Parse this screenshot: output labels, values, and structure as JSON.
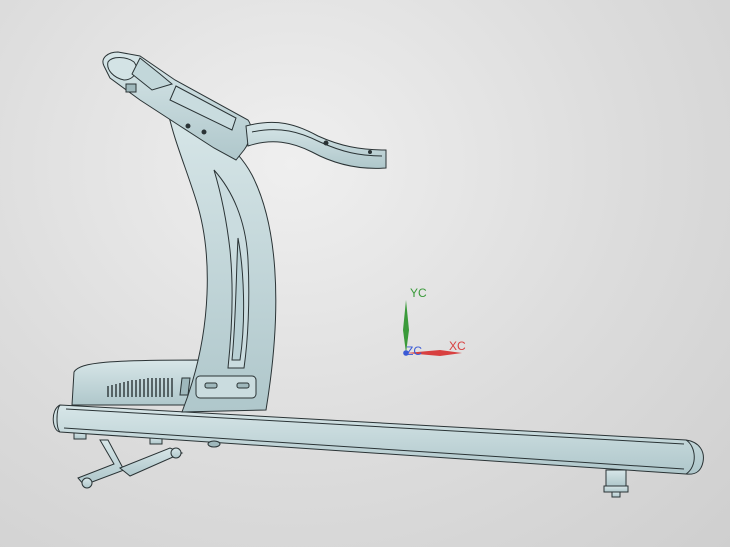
{
  "viewport": {
    "background_top": "#efefef",
    "background_bottom": "#cfcfcf"
  },
  "model": {
    "name": "treadmill-model",
    "body_color": "#c4d9dc",
    "edge_color": "#2a3335"
  },
  "triad": {
    "y_label": "YC",
    "z_label": "ZC",
    "x_label": "XC",
    "y_color": "#3a9a3a",
    "z_color": "#3a5ad6",
    "x_color": "#d84040"
  }
}
